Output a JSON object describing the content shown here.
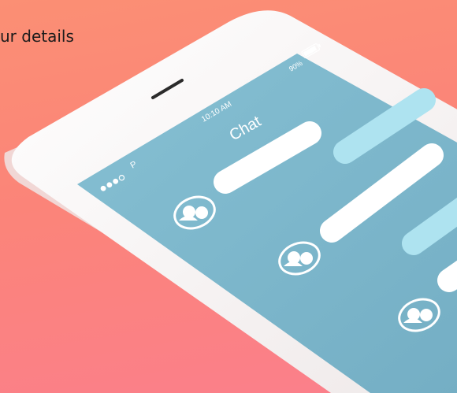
{
  "page": {
    "heading": "ur details"
  },
  "phone": {
    "status_bar": {
      "signal": "●●●○ P",
      "time": "10:10 AM",
      "battery_percent": "90%",
      "battery_level": 0.9
    },
    "chat": {
      "title": "Chat",
      "messages": [
        {
          "sender": "contact",
          "avatar": "user-avatar-icon",
          "bubble_color": "#ffffff"
        },
        {
          "sender": "me",
          "bubble_color": "#aee3f0"
        },
        {
          "sender": "contact",
          "avatar": "user-avatar-icon",
          "bubble_color": "#ffffff"
        },
        {
          "sender": "me",
          "bubble_color": "#aee3f0"
        },
        {
          "sender": "contact",
          "avatar": "user-avatar-icon",
          "bubble_color": "#ffffff"
        }
      ]
    }
  },
  "colors": {
    "background_top": "#fb8f74",
    "background_bottom": "#fb7f8c",
    "screen": "#7fb9ce",
    "bubble_in": "#ffffff",
    "bubble_out": "#aee3f0",
    "device_frame": "#f7f5f5"
  }
}
